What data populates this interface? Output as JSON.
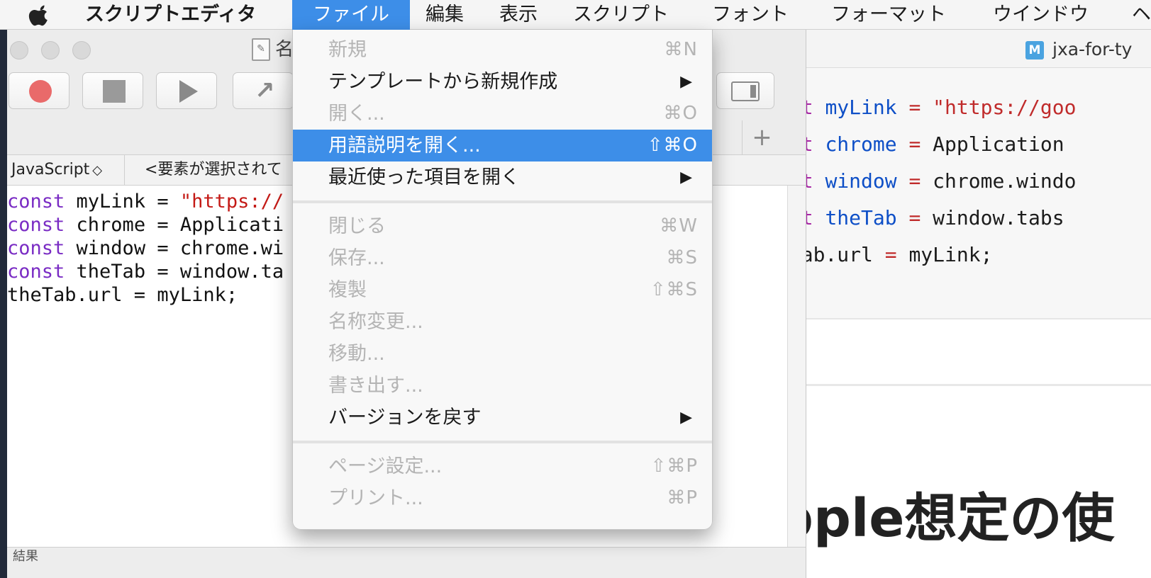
{
  "menubar": {
    "app_name": "スクリプトエディタ",
    "menus": [
      "ファイル",
      "編集",
      "表示",
      "スクリプト",
      "フォント",
      "フォーマット",
      "ウインドウ",
      "ヘ"
    ],
    "active_menu": "ファイル"
  },
  "file_menu": {
    "items": [
      {
        "label": "新規",
        "shortcut": "⌘N",
        "disabled": true
      },
      {
        "label": "テンプレートから新規作成",
        "submenu": "▶"
      },
      {
        "label": "開く...",
        "shortcut": "⌘O",
        "disabled": true
      },
      {
        "label": "用語説明を開く...",
        "shortcut": "⇧⌘O",
        "highlighted": true
      },
      {
        "label": "最近使った項目を開く",
        "submenu": "▶"
      },
      {
        "label": "閉じる",
        "shortcut": "⌘W",
        "disabled": true
      },
      {
        "label": "保存...",
        "shortcut": "⌘S",
        "disabled": true
      },
      {
        "label": "複製",
        "shortcut": "⇧⌘S",
        "disabled": true
      },
      {
        "label": "名称変更...",
        "disabled": true
      },
      {
        "label": "移動...",
        "disabled": true
      },
      {
        "label": "書き出す...",
        "disabled": true
      },
      {
        "label": "バージョンを戻す",
        "submenu": "▶"
      },
      {
        "label": "ページ設定...",
        "shortcut": "⇧⌘P",
        "disabled": true
      },
      {
        "label": "プリント...",
        "shortcut": "⌘P",
        "disabled": true
      }
    ]
  },
  "editor": {
    "title_fragment": "名",
    "language": "JavaScript",
    "element_placeholder": "<要素が選択されて",
    "code_lines": [
      {
        "kw": "const",
        "rest": " myLink = ",
        "str": "\"https://"
      },
      {
        "kw": "const",
        "rest": " chrome = Applicati",
        "str": ""
      },
      {
        "kw": "const",
        "rest": " window = chrome.wi",
        "str": ""
      },
      {
        "kw": "const",
        "rest": " theTab = window.ta",
        "str": ""
      },
      {
        "kw": "",
        "rest": "theTab.url = myLink;",
        "str": ""
      }
    ],
    "add_symbol": "+",
    "status_fragment": "結果"
  },
  "browser": {
    "tab_icon": "M",
    "tab_title": "jxa-for-ty",
    "code_lines": [
      {
        "kw": "nst",
        "var": "myLink",
        "op": "=",
        "rest": "\"https://goo"
      },
      {
        "kw": "nst",
        "var": "chrome",
        "op": "=",
        "rest": "Application"
      },
      {
        "kw": "nst",
        "var": "window",
        "op": "=",
        "rest": "chrome.windo"
      },
      {
        "kw": "nst",
        "var": "theTab",
        "op": "=",
        "rest": "window.tabs"
      },
      {
        "kw": "",
        "var": "",
        "op": "=",
        "rest": "eTab.url",
        "tail": "myLink;"
      }
    ],
    "heading": "pple想定の使"
  }
}
